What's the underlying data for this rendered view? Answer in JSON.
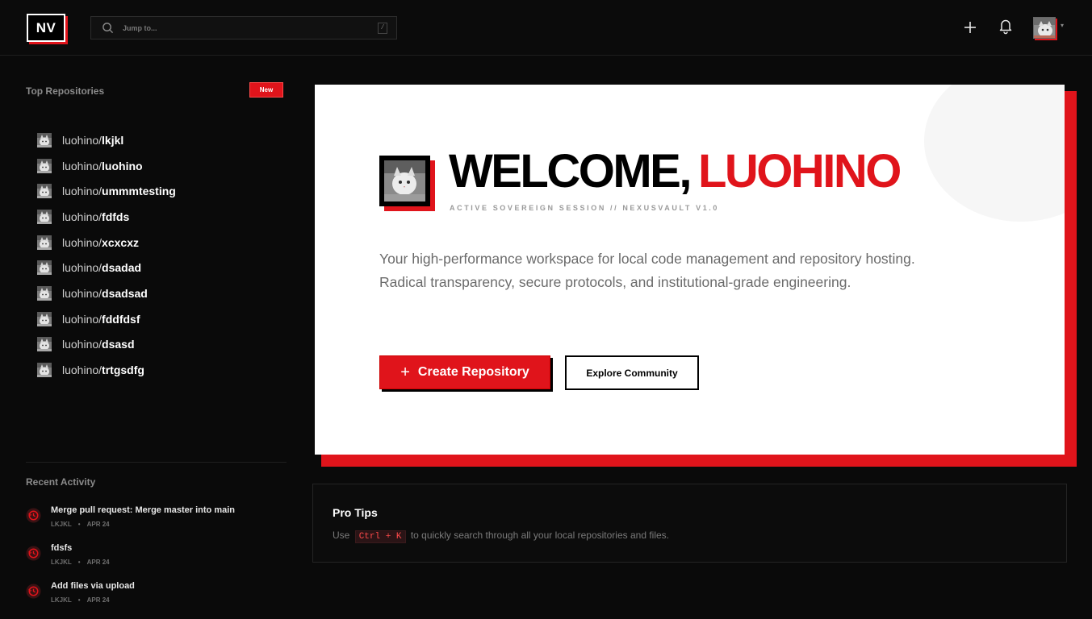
{
  "topbar": {
    "logo": "NV",
    "search_placeholder": "Jump to...",
    "search_shortcut": "/",
    "plus_icon": "plus-icon",
    "bell_icon": "bell-icon",
    "caret": "▾"
  },
  "sidebar": {
    "repos_heading": "Top Repositories",
    "new_label": "New",
    "repos": [
      {
        "owner": "luohino/",
        "name": "lkjkl"
      },
      {
        "owner": "luohino/",
        "name": "luohino"
      },
      {
        "owner": "luohino/",
        "name": "ummmtesting"
      },
      {
        "owner": "luohino/",
        "name": "fdfds"
      },
      {
        "owner": "luohino/",
        "name": "xcxcxz"
      },
      {
        "owner": "luohino/",
        "name": "dsadad"
      },
      {
        "owner": "luohino/",
        "name": "dsadsad"
      },
      {
        "owner": "luohino/",
        "name": "fddfdsf"
      },
      {
        "owner": "luohino/",
        "name": "dsasd"
      },
      {
        "owner": "luohino/",
        "name": "trtgsdfg"
      }
    ],
    "activity_heading": "Recent Activity",
    "activity": [
      {
        "title": "Merge pull request: Merge master into main",
        "repo": "LKJKL",
        "date": "APR 24"
      },
      {
        "title": "fdsfs",
        "repo": "LKJKL",
        "date": "APR 24"
      },
      {
        "title": "Add files via upload",
        "repo": "LKJKL",
        "date": "APR 24"
      }
    ]
  },
  "hero": {
    "welcome": "WELCOME,",
    "username": "LUOHINO",
    "session": "ACTIVE SOVEREIGN SESSION // NEXUSVAULT V1.0",
    "description": "Your high-performance workspace for local code management and repository hosting. Radical transparency, secure protocols, and institutional-grade engineering.",
    "create_plus": "+",
    "create_label": "Create Repository",
    "explore_label": "Explore Community"
  },
  "tips": {
    "title": "Pro Tips",
    "text_before": "Use",
    "shortcut": "Ctrl + K",
    "text_after": "to quickly search through all your local repositories and files."
  },
  "colors": {
    "accent": "#e0141b",
    "background": "#0a0a0a",
    "card": "#ffffff"
  }
}
